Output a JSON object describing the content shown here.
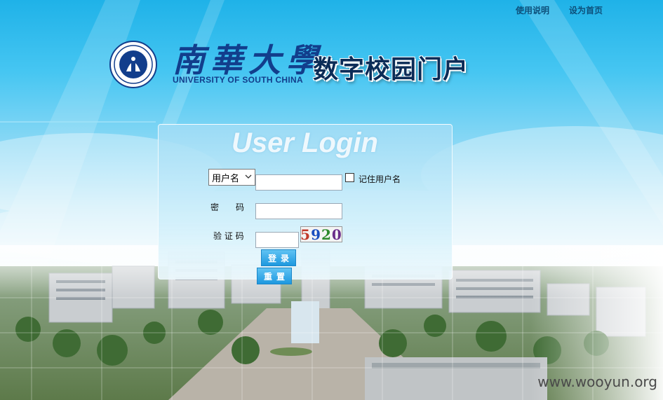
{
  "toplinks": {
    "help": "使用说明",
    "homepage": "设为首页"
  },
  "logo": {
    "cn_name": "南華大學",
    "en_name": "UNIVERSITY OF SOUTH CHINA",
    "portal_title": "数字校园门户"
  },
  "login": {
    "title": "User Login",
    "account_type_selected": "用户名",
    "username_value": "",
    "remember_label": "记住用户名",
    "password_label": "密　　码",
    "password_value": "",
    "captcha_label": "验 证 码",
    "captcha_value": "",
    "captcha_text": {
      "d1": "5",
      "d2": "9",
      "d3": "2",
      "d4": "0"
    },
    "login_button": "登录",
    "reset_button": "重置"
  },
  "watermark": "www.wooyun.org",
  "colors": {
    "brand_blue": "#123e8c",
    "sky_top": "#1fb2e8",
    "button_blue": "#1e98df"
  }
}
